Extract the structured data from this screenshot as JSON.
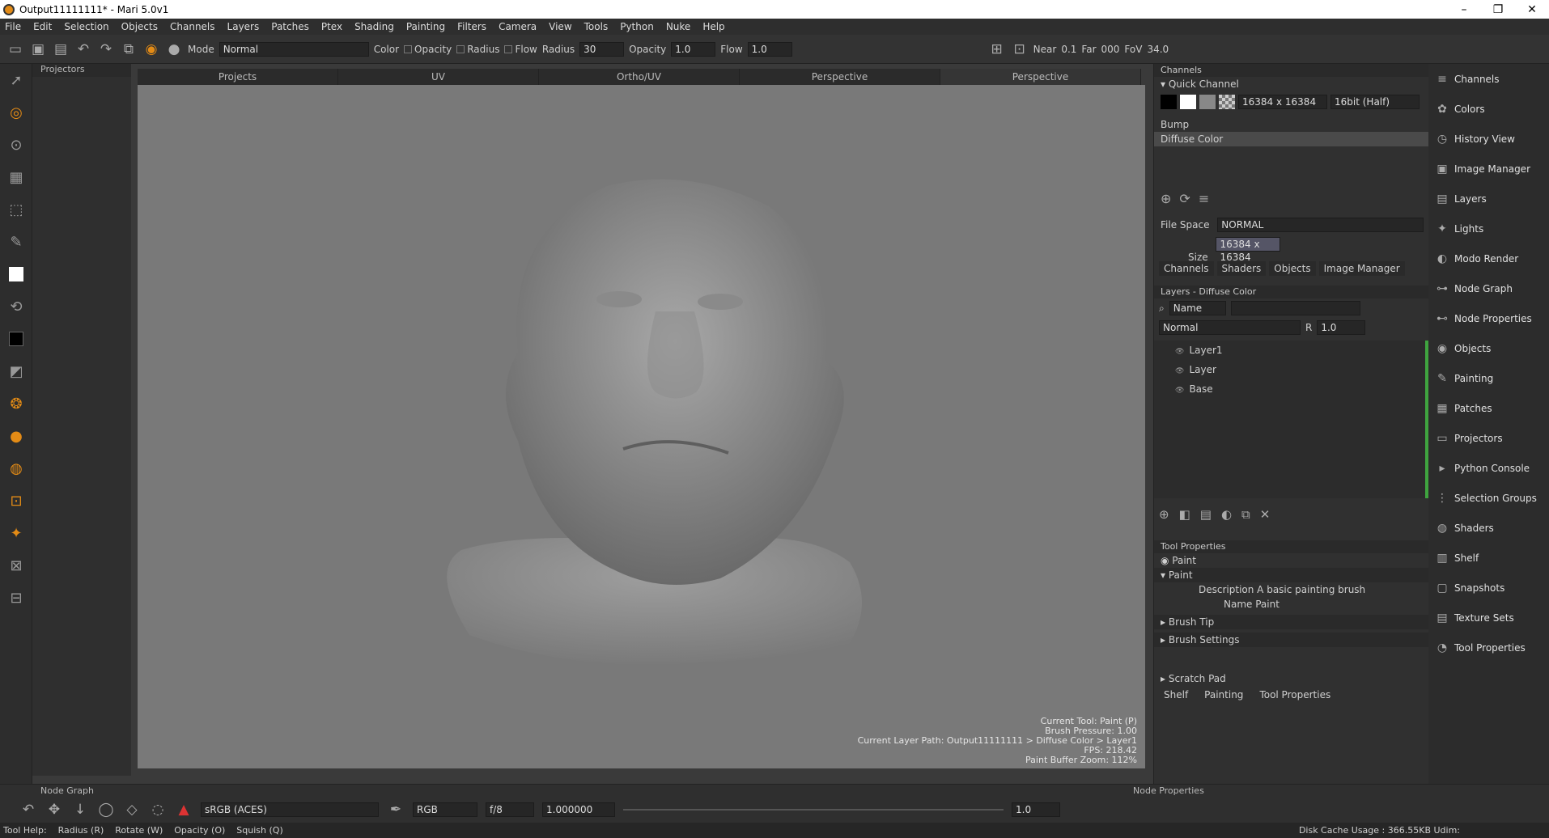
{
  "window": {
    "title": "Output11111111* - Mari 5.0v1"
  },
  "menu": [
    "File",
    "Edit",
    "Selection",
    "Objects",
    "Channels",
    "Layers",
    "Patches",
    "Ptex",
    "Shading",
    "Painting",
    "Filters",
    "Camera",
    "View",
    "Tools",
    "Python",
    "Nuke",
    "Help"
  ],
  "toolbar": {
    "mode_label": "Mode",
    "mode_value": "Normal",
    "color_label": "Color",
    "opacity_label": "Opacity",
    "radius_label": "Radius",
    "flow_label": "Flow",
    "radius2_label": "Radius",
    "radius_value": "30",
    "opacity2_label": "Opacity",
    "opacity_value": "1.0",
    "flow2_label": "Flow",
    "flow_value": "1.0",
    "near_label": "Near",
    "near_value": "0.1",
    "far_label": "Far",
    "far_value": "000",
    "fov_label": "FoV",
    "fov_value": "34.0"
  },
  "left_panel": {
    "title": "Projectors"
  },
  "viewport_tabs": [
    "Projects",
    "UV",
    "Ortho/UV",
    "Perspective",
    "Perspective"
  ],
  "hud": [
    "Current Tool: Paint (P)",
    "Brush Pressure: 1.00",
    "Current Layer Path: Output11111111 > Diffuse Color > Layer1",
    "FPS: 218.42",
    "Paint Buffer Zoom: 112%"
  ],
  "channels": {
    "title": "Channels",
    "quick": "Quick Channel",
    "size": "16384 x 16384",
    "depth": "16bit (Half)",
    "list": [
      "Bump",
      "Diffuse Color"
    ],
    "filespace_label": "File Space",
    "filespace_value": "NORMAL",
    "size_label": "Size",
    "size_value": "16384 x 16384",
    "tabs": [
      "Channels",
      "Shaders",
      "Objects",
      "Image Manager"
    ]
  },
  "layers": {
    "title": "Layers - Diffuse Color",
    "filter": "Name",
    "blend": "Normal",
    "opacity": "1.0",
    "items": [
      "Layer1",
      "Layer",
      "Base"
    ]
  },
  "tool_props": {
    "title": "Tool Properties",
    "tool": "Paint",
    "section": "Paint",
    "desc_label": "Description",
    "desc_value": "A basic painting brush",
    "name_label": "Name",
    "name_value": "Paint",
    "brush_tip": "Brush Tip",
    "brush_settings": "Brush Settings"
  },
  "scratch": {
    "title": "Scratch Pad",
    "tabs": [
      "Shelf",
      "Painting",
      "Tool Properties"
    ]
  },
  "right_nav": [
    "Channels",
    "Colors",
    "History View",
    "Image Manager",
    "Layers",
    "Lights",
    "Modo Render",
    "Node Graph",
    "Node Properties",
    "Objects",
    "Painting",
    "Patches",
    "Projectors",
    "Python Console",
    "Selection Groups",
    "Shaders",
    "Shelf",
    "Snapshots",
    "Texture Sets",
    "Tool Properties"
  ],
  "bottom": {
    "node_graph": "Node Graph",
    "node_props": "Node Properties",
    "colorspace": "sRGB (ACES)",
    "channel": "RGB",
    "fstop": "f/8",
    "exposure": "1.000000",
    "gain": "1.0"
  },
  "status": {
    "help": "Tool Help:",
    "radius": "Radius (R)",
    "rotate": "Rotate (W)",
    "opacity": "Opacity (O)",
    "squish": "Squish (Q)",
    "disk": "Disk Cache Usage : 366.55KB Udim:"
  }
}
